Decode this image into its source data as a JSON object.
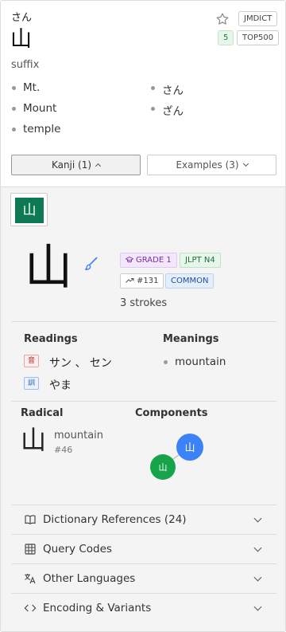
{
  "entry": {
    "reading": "さん",
    "kanji": "山",
    "favorite_icon": "star-outline-icon",
    "tags": {
      "source": "JMDICT",
      "level": "5",
      "frequency": "TOP500"
    },
    "part_of_speech": "suffix",
    "senses_left": [
      "Mt.",
      "Mount",
      "temple"
    ],
    "senses_right": [
      "さん",
      "ざん"
    ],
    "tabs": {
      "kanji": "Kanji (1)",
      "examples": "Examples (3)"
    }
  },
  "kanji_detail": {
    "tile_char": "山",
    "character": "山",
    "tile_color": "#0e7a53",
    "badges": {
      "grade": "GRADE 1",
      "jlpt": "JLPT N4",
      "rank": "#131",
      "common": "COMMON"
    },
    "strokes": "3 strokes",
    "readings_title": "Readings",
    "on_label": "音",
    "on_reading": "サン 、 セン",
    "kun_label": "訓",
    "kun_reading": "やま",
    "meanings_title": "Meanings",
    "meaning": "mountain",
    "radical_title": "Radical",
    "radical_char": "山",
    "radical_name": "mountain",
    "radical_number": "#46",
    "components_title": "Components",
    "component_nodes": [
      {
        "char": "山",
        "color": "#3b82f6"
      },
      {
        "char": "山",
        "color": "#16a34a"
      }
    ]
  },
  "accordions": [
    {
      "label": "Dictionary References (24)",
      "icon": "book-icon"
    },
    {
      "label": "Query Codes",
      "icon": "grid-icon"
    },
    {
      "label": "Other Languages",
      "icon": "translate-icon"
    },
    {
      "label": "Encoding & Variants",
      "icon": "code-icon"
    }
  ]
}
